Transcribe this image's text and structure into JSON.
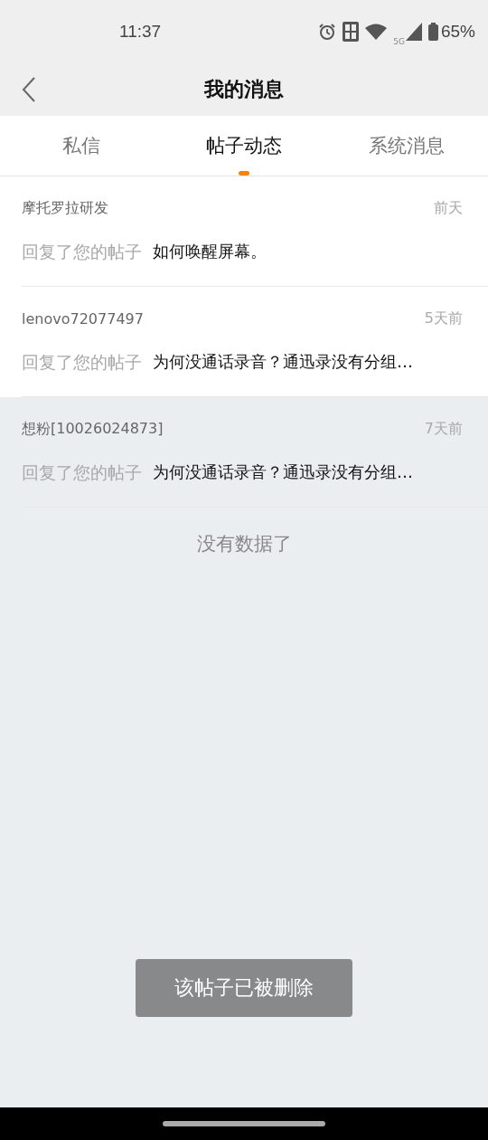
{
  "status_bar": {
    "time": "11:37",
    "network": "5G",
    "battery": "65%"
  },
  "header": {
    "title": "我的消息"
  },
  "tabs": [
    {
      "label": "私信",
      "selected": false
    },
    {
      "label": "帖子动态",
      "selected": true
    },
    {
      "label": "系统消息",
      "selected": false
    }
  ],
  "messages": [
    {
      "user": "摩托罗拉研发",
      "time": "前天",
      "action": "回复了您的帖子",
      "text": "如何唤醒屏幕。",
      "pressed": false
    },
    {
      "user": "lenovo72077497",
      "time": "5天前",
      "action": "回复了您的帖子",
      "text": "为何没通话录音？通迅录没有分组…",
      "pressed": false
    },
    {
      "user": "想粉[10026024873]",
      "time": "7天前",
      "action": "回复了您的帖子",
      "text": "为何没通话录音？通迅录没有分组…",
      "pressed": true
    }
  ],
  "end_note": "没有数据了",
  "toast": "该帖子已被删除"
}
